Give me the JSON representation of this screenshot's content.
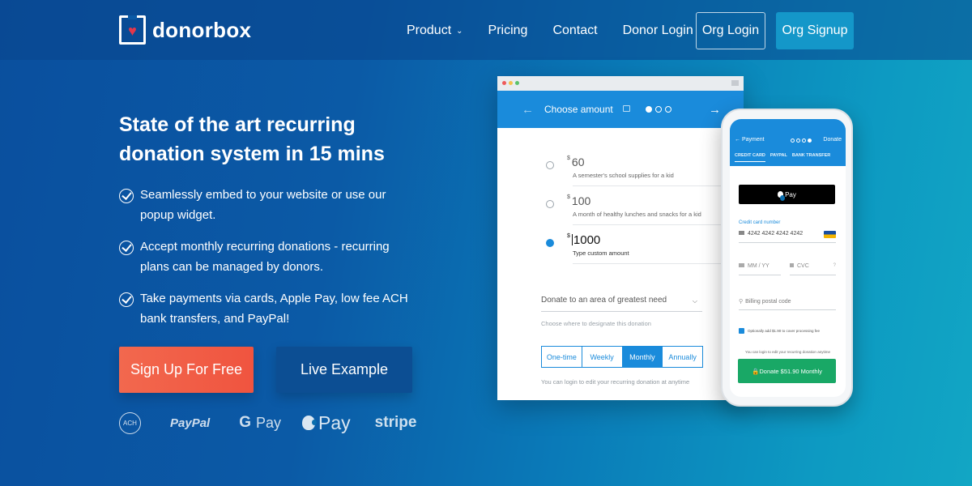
{
  "brand": {
    "name": "donorbox",
    "icon": "heart-box-icon",
    "heart_color": "#e3374b"
  },
  "nav": {
    "links": [
      {
        "label": "Product",
        "dropdown": true
      },
      {
        "label": "Pricing"
      },
      {
        "label": "Contact"
      },
      {
        "label": "Donor Login"
      }
    ],
    "org_login": "Org Login",
    "org_signup": "Org Signup"
  },
  "hero": {
    "headline_line1": "State of the art recurring",
    "headline_line2": "donation system in 15 mins",
    "features": [
      {
        "line1": "Seamlessly embed to your website or use our",
        "line2": "popup widget."
      },
      {
        "line1": "Accept monthly recurring donations - recurring",
        "line2": "plans can be managed by donors."
      },
      {
        "line1": "Take payments via cards, Apple Pay, low fee ACH",
        "line2": "bank transfers, and PayPal!"
      }
    ],
    "signup_button": "Sign Up For Free",
    "live_button": "Live Example",
    "signup_color": "#f2604a",
    "payment_logos": {
      "ach": "ACH",
      "paypal": "PayPal",
      "gpay_g": "G",
      "gpay": "Pay",
      "applepay": "Pay",
      "stripe": "stripe"
    }
  },
  "desktop_form": {
    "header_title": "Choose amount",
    "back_arrow": "←",
    "forward_arrow": "→",
    "accent": "#1a8bdb",
    "currency": "$",
    "amounts": [
      {
        "value": "60",
        "desc": "A semester's school supplies for a kid",
        "selected": false
      },
      {
        "value": "100",
        "desc": "A month of healthy lunches and snacks for a kid",
        "selected": false
      },
      {
        "value": "1000",
        "desc": "Type custom amount",
        "selected": true
      }
    ],
    "designation": "Donate to an area of greatest need",
    "designation_hint": "Choose where to designate this donation",
    "frequencies": [
      "One-time",
      "Weekly",
      "Monthly",
      "Annually"
    ],
    "selected_frequency": "Monthly",
    "footer": "You can login to edit  your recurring donation at anytime"
  },
  "phone_form": {
    "header_title": "← Payment",
    "header_right": "Donate",
    "tabs": [
      "CREDIT CARD",
      "PAYPAL",
      "BANK TRANSFER"
    ],
    "apple_pay": " Pay",
    "card_label": "Credit card number",
    "card_number": "4242 4242 4242 4242",
    "expiry_placeholder": "MM / YY",
    "cvc_placeholder": "CVC",
    "cvc_help": "?",
    "postal_placeholder": "Billing postal code",
    "cover_fee": "Optionally add $1.90 to cover processing fee",
    "login_note": "You can login to edit your recurring donation anytime",
    "donate_button": "🔒Donate $51.90 Monthly",
    "donate_color": "#19a866"
  }
}
